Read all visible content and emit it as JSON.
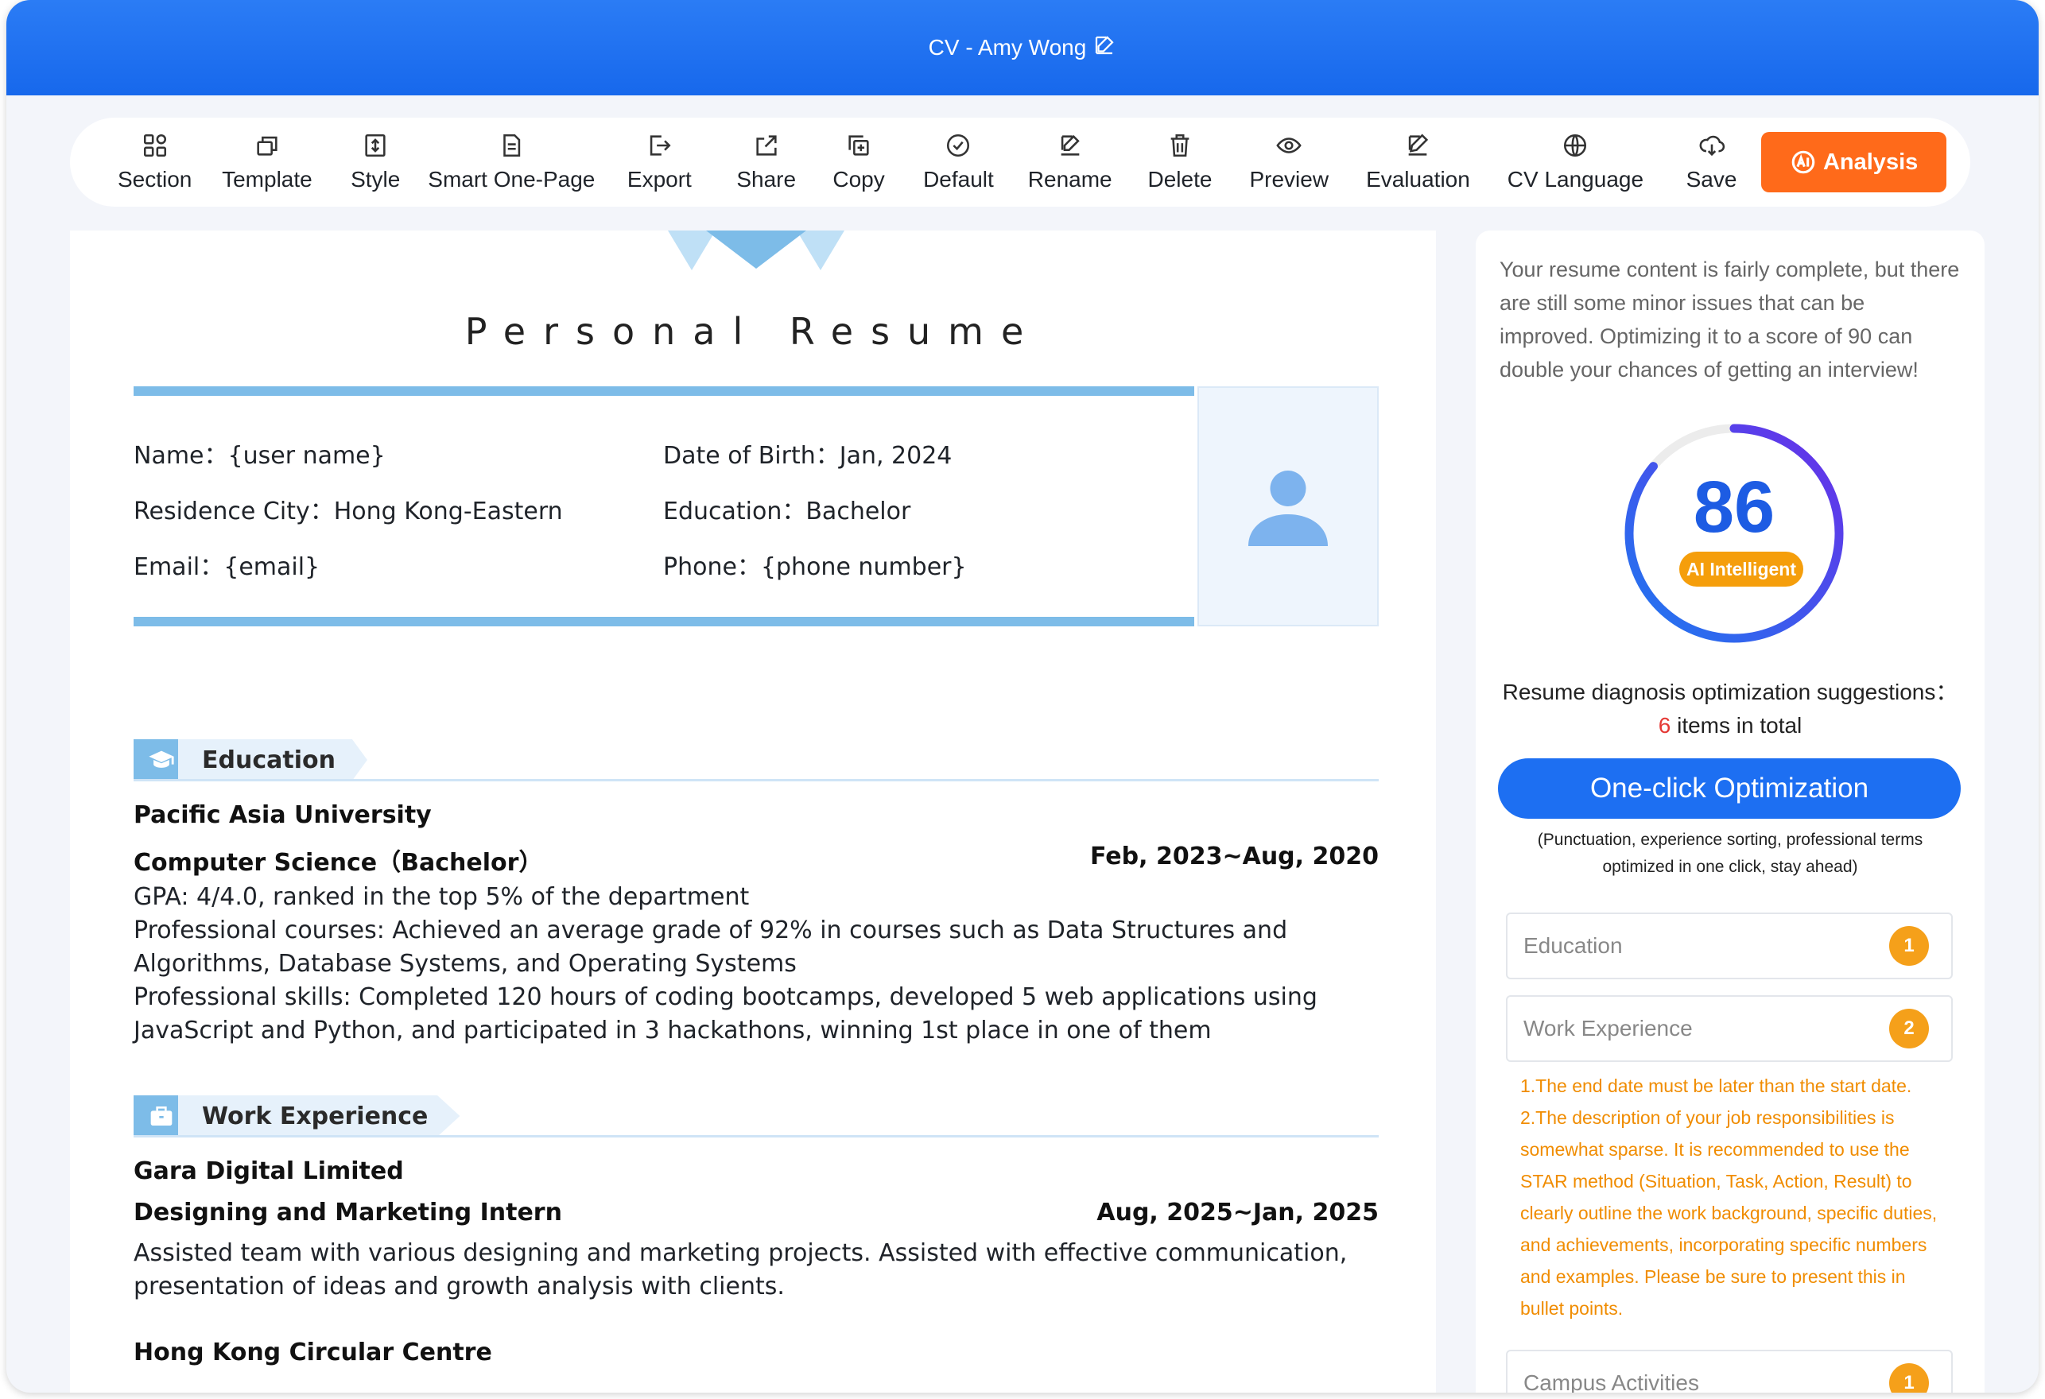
{
  "window": {
    "title": "CV - Amy Wong"
  },
  "toolbar": {
    "items": [
      {
        "label": "Section",
        "icon": "grid-icon"
      },
      {
        "label": "Template",
        "icon": "layers-icon"
      },
      {
        "label": "Style",
        "icon": "style-icon"
      },
      {
        "label": "Smart One-Page",
        "icon": "document-icon"
      },
      {
        "label": "Export",
        "icon": "export-icon"
      },
      {
        "label": "Share",
        "icon": "share-icon"
      },
      {
        "label": "Copy",
        "icon": "copy-icon"
      },
      {
        "label": "Default",
        "icon": "check-circle-icon"
      },
      {
        "label": "Rename",
        "icon": "edit-icon"
      },
      {
        "label": "Delete",
        "icon": "trash-icon"
      },
      {
        "label": "Preview",
        "icon": "eye-icon"
      },
      {
        "label": "Evaluation",
        "icon": "pen-icon"
      },
      {
        "label": "CV Language",
        "icon": "globe-icon"
      },
      {
        "label": "Save",
        "icon": "cloud-icon"
      }
    ],
    "analysis_label": "Analysis"
  },
  "resume": {
    "title": "Personal Resume",
    "info": {
      "name": "Name：{user name}",
      "dob": "Date of Birth：Jan, 2024",
      "city": "Residence City：Hong Kong-Eastern",
      "education": "Education：Bachelor",
      "email": "Email：{email}",
      "phone": "Phone：{phone number}"
    },
    "sections": {
      "education": {
        "heading": "Education",
        "school": "Pacific Asia University",
        "degree": "Computer Science（Bachelor）",
        "date": "Feb, 2023~Aug, 2020",
        "lines": [
          "GPA: 4/4.0, ranked in the top 5% of the department",
          "Professional courses: Achieved an average grade of 92% in courses such as Data Structures and Algorithms, Database Systems, and Operating Systems",
          "Professional skills: Completed 120 hours of coding bootcamps, developed 5 web applications using JavaScript and Python, and participated in 3 hackathons, winning 1st place in one of them"
        ]
      },
      "work": {
        "heading": "Work Experience",
        "company1": "Gara Digital Limited",
        "role1": "Designing and Marketing Intern",
        "date1": "Aug, 2025~Jan, 2025",
        "desc1": "Assisted team with various designing and marketing projects. Assisted with effective communication, presentation of ideas and growth analysis with clients.",
        "company2": "Hong Kong Circular Centre"
      }
    }
  },
  "panel": {
    "intro": "Your resume content is fairly complete, but there are still some minor issues that can be improved. Optimizing it to a score of 90 can double your chances of getting an interview!",
    "score": "86",
    "score_value": 86,
    "score_badge": "AI Intelligent",
    "diag_title": "Resume diagnosis optimization suggestions：",
    "diag_count": "6",
    "diag_suffix": " items in total",
    "optimize_label": "One-click Optimization",
    "optimize_note": "(Punctuation, experience sorting, professional terms optimized in one click, stay ahead)",
    "items": [
      {
        "label": "Education",
        "count": "1"
      },
      {
        "label": "Work Experience",
        "count": "2"
      },
      {
        "label": "Campus Activities",
        "count": "1"
      }
    ],
    "work_suggestions": [
      "1.The end date must be later than the start date.",
      "2.The description of your job responsibilities is somewhat sparse. It is recommended to use the STAR method (Situation, Task, Action, Result) to clearly outline the work background, specific duties, and achievements, incorporating specific numbers and examples. Please be sure to present this in bullet points."
    ]
  },
  "colors": {
    "primary": "#1d6ff2",
    "accent": "#ff6a1a",
    "band": "#7dbce8",
    "warning": "#f08c00"
  }
}
